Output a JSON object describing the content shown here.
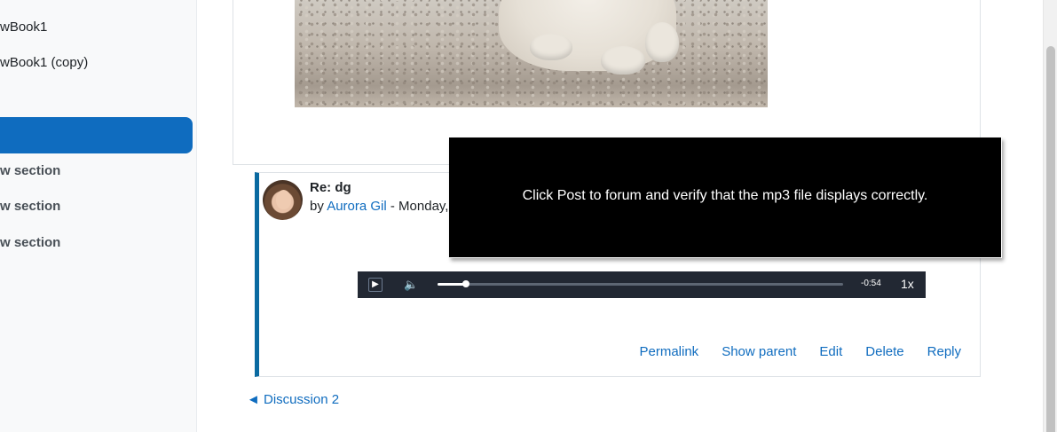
{
  "drawer": {
    "items": [
      {
        "label": "wBook1"
      },
      {
        "label": "wBook1 (copy)"
      }
    ],
    "sections": [
      {
        "label": "w section"
      },
      {
        "label": "w section"
      },
      {
        "label": "w section"
      }
    ]
  },
  "reply": {
    "subject": "Re: dg",
    "by_prefix": "by ",
    "author": "Aurora Gil",
    "date_fragment": " - Monday,"
  },
  "audio": {
    "play_icon": "play-icon",
    "volume_icon": "volume-icon",
    "progress_fraction": 0.07,
    "time_remaining": "-0:54",
    "playback_rate": "1x"
  },
  "actions": {
    "permalink": "Permalink",
    "show_parent": "Show parent",
    "edit": "Edit",
    "delete": "Delete",
    "reply": "Reply"
  },
  "navigation": {
    "previous_discussion": "◄ Discussion 2"
  },
  "tour": {
    "message": "Click Post to forum and verify that the mp3 file displays correctly."
  },
  "colors": {
    "link": "#0f6cbf",
    "active_drawer": "#0f6cbf",
    "reply_border": "#0a6aa1",
    "player_bg": "#222833",
    "popover_bg": "#000000"
  }
}
